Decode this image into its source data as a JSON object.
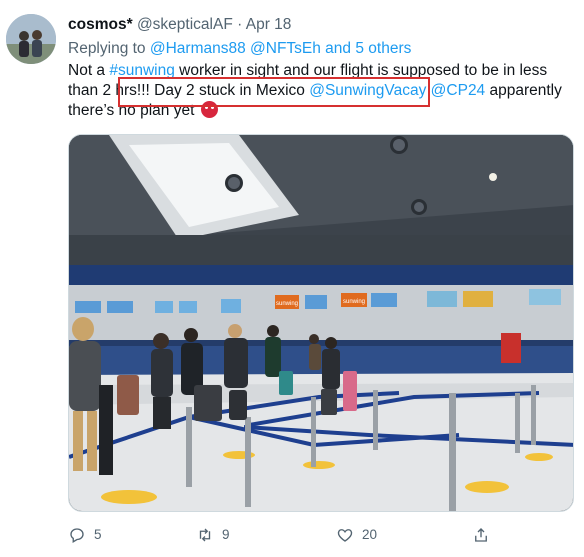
{
  "tweet": {
    "display_name": "cosmos*",
    "handle": "@skepticalAF",
    "separator": "·",
    "date": "Apr 18",
    "replying_prefix": "Replying to",
    "reply_users": "@Harmans88 @NFTsEh and 5 others",
    "body_part1": "Not a ",
    "hashtag": "#sunwing",
    "body_part2": " worker in sight and our flight is supposed to be in less than 2 hrs!!! ",
    "highlight_text": "Day 2 stuck in Mexico ",
    "mention1": "@SunwingVacay",
    "mention2": "@CP24",
    "body_part3": " apparently there’s no plan yet",
    "emoji_name": "angry-cursing-face-emoji"
  },
  "photo_signs": {
    "sign1": "sunwing",
    "sign2": "sunwing"
  },
  "actions": {
    "reply_count": "5",
    "retweet_count": "9",
    "like_count": "20"
  },
  "colors": {
    "link": "#1d9bf0",
    "highlight_box": "#d63030",
    "muted": "#536471"
  }
}
